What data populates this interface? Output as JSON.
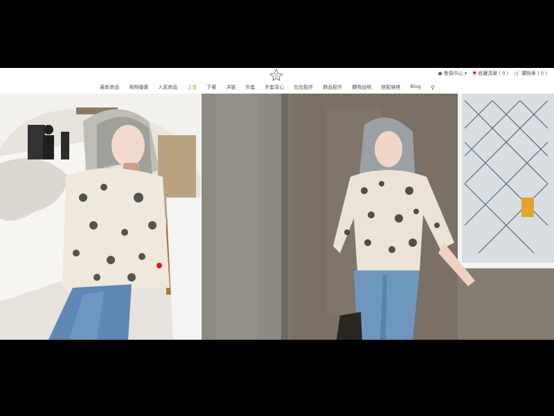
{
  "header": {
    "logo_alt": "store logo",
    "util": {
      "member_label": "會員中心",
      "wishlist_label": "收藏清單",
      "wishlist_count": "0",
      "cart_label": "購物車",
      "cart_count": "0"
    }
  },
  "nav": {
    "items": [
      {
        "label": "最新商品"
      },
      {
        "label": "限時優惠"
      },
      {
        "label": "人氣商品"
      },
      {
        "label": "上衣"
      },
      {
        "label": "下著"
      },
      {
        "label": "洋裝"
      },
      {
        "label": "外套"
      },
      {
        "label": "外套背心"
      },
      {
        "label": "包包配件"
      },
      {
        "label": "飾品配件"
      },
      {
        "label": "購物說明"
      },
      {
        "label": "搭配穿搭"
      },
      {
        "label": "Blog"
      }
    ]
  },
  "hero": {
    "slides": [
      {
        "description_icon": "model-photo-left"
      },
      {
        "description_icon": "model-photo-right"
      }
    ]
  },
  "colors": {
    "accent": "#c47b2b",
    "heart": "#e0214b",
    "frame": "#000000"
  }
}
